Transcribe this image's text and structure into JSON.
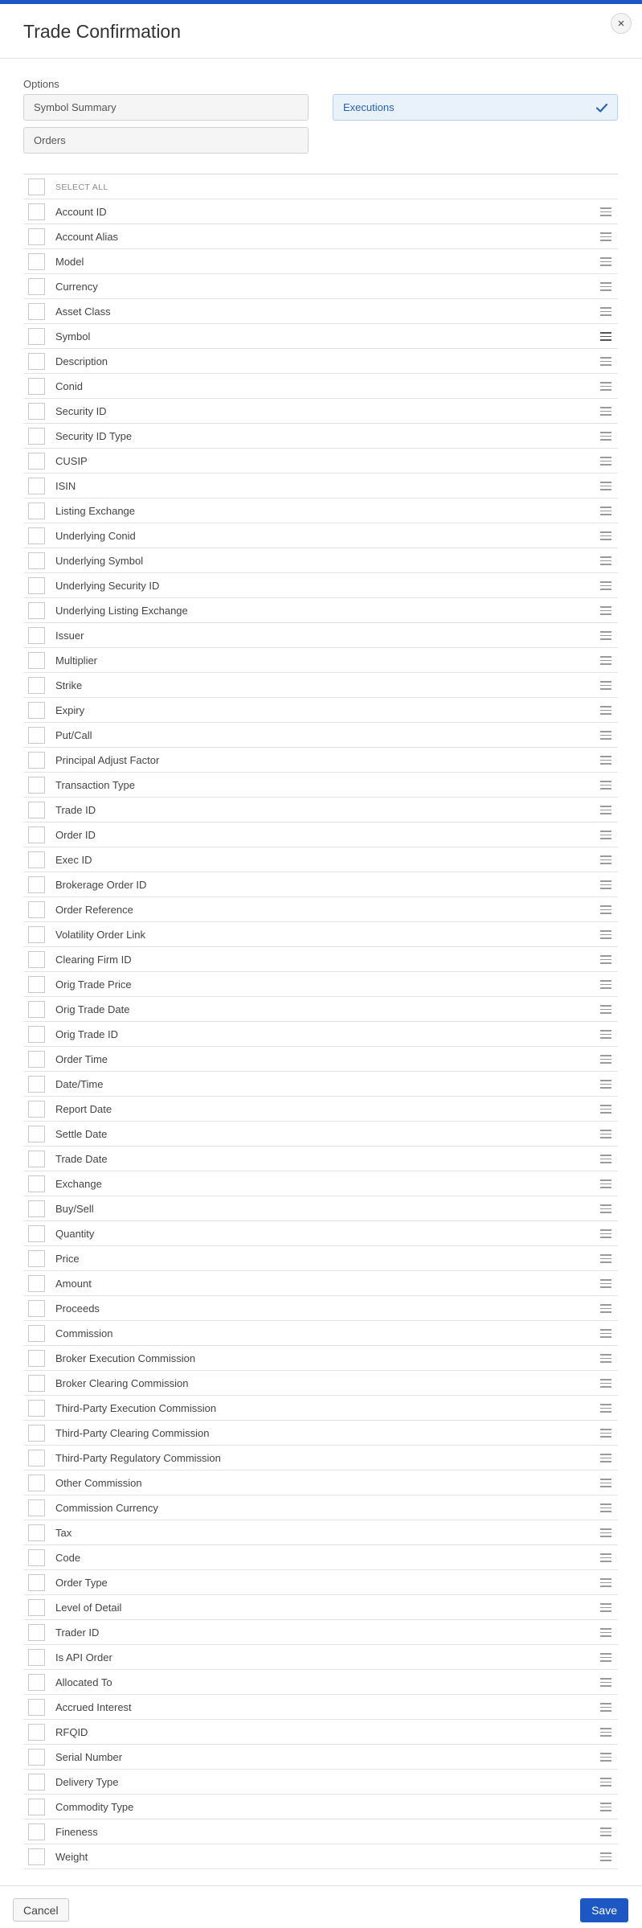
{
  "dialog": {
    "title": "Trade Confirmation",
    "close_icon": "×"
  },
  "options": {
    "label": "Options",
    "items": [
      {
        "label": "Symbol Summary",
        "selected": false
      },
      {
        "label": "Executions",
        "selected": true
      },
      {
        "label": "Orders",
        "selected": false
      }
    ]
  },
  "fields": {
    "select_all_label": "SELECT ALL",
    "items": [
      "Account ID",
      "Account Alias",
      "Model",
      "Currency",
      "Asset Class",
      "Symbol",
      "Description",
      "Conid",
      "Security ID",
      "Security ID Type",
      "CUSIP",
      "ISIN",
      "Listing Exchange",
      "Underlying Conid",
      "Underlying Symbol",
      "Underlying Security ID",
      "Underlying Listing Exchange",
      "Issuer",
      "Multiplier",
      "Strike",
      "Expiry",
      "Put/Call",
      "Principal Adjust Factor",
      "Transaction Type",
      "Trade ID",
      "Order ID",
      "Exec ID",
      "Brokerage Order ID",
      "Order Reference",
      "Volatility Order Link",
      "Clearing Firm ID",
      "Orig Trade Price",
      "Orig Trade Date",
      "Orig Trade ID",
      "Order Time",
      "Date/Time",
      "Report Date",
      "Settle Date",
      "Trade Date",
      "Exchange",
      "Buy/Sell",
      "Quantity",
      "Price",
      "Amount",
      "Proceeds",
      "Commission",
      "Broker Execution Commission",
      "Broker Clearing Commission",
      "Third-Party Execution Commission",
      "Third-Party Clearing Commission",
      "Third-Party Regulatory Commission",
      "Other Commission",
      "Commission Currency",
      "Tax",
      "Code",
      "Order Type",
      "Level of Detail",
      "Trader ID",
      "Is API Order",
      "Allocated To",
      "Accrued Interest",
      "RFQID",
      "Serial Number",
      "Delivery Type",
      "Commodity Type",
      "Fineness",
      "Weight"
    ]
  },
  "footer": {
    "cancel_label": "Cancel",
    "save_label": "Save"
  },
  "colors": {
    "accent": "#1d57c4",
    "selected_bg": "#e9f1fb",
    "selected_text": "#2a62b8"
  }
}
